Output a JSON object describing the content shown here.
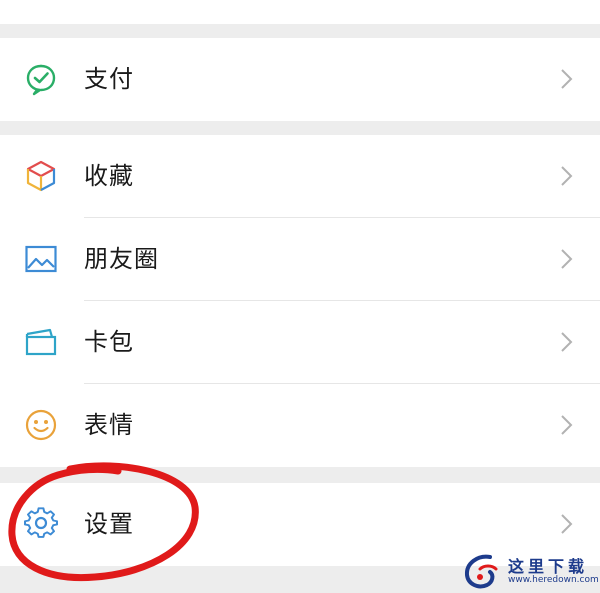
{
  "menu": {
    "payment": {
      "label": "支付",
      "icon": "payment-icon",
      "accent": "#2aae67"
    },
    "favorites": {
      "label": "收藏",
      "icon": "favorites-cube-icon"
    },
    "moments": {
      "label": "朋友圈",
      "icon": "moments-picture-icon",
      "accent": "#3d8bd5"
    },
    "cards": {
      "label": "卡包",
      "icon": "card-wallet-icon",
      "accent": "#2ea4c8"
    },
    "stickers": {
      "label": "表情",
      "icon": "sticker-smile-icon",
      "accent": "#e9a23a"
    },
    "settings": {
      "label": "设置",
      "icon": "gear-icon",
      "accent": "#3d8bd5"
    }
  },
  "annotation": {
    "color": "#e01a1a"
  },
  "watermark": {
    "text": "这里下载",
    "url": "www.heredown.com"
  }
}
